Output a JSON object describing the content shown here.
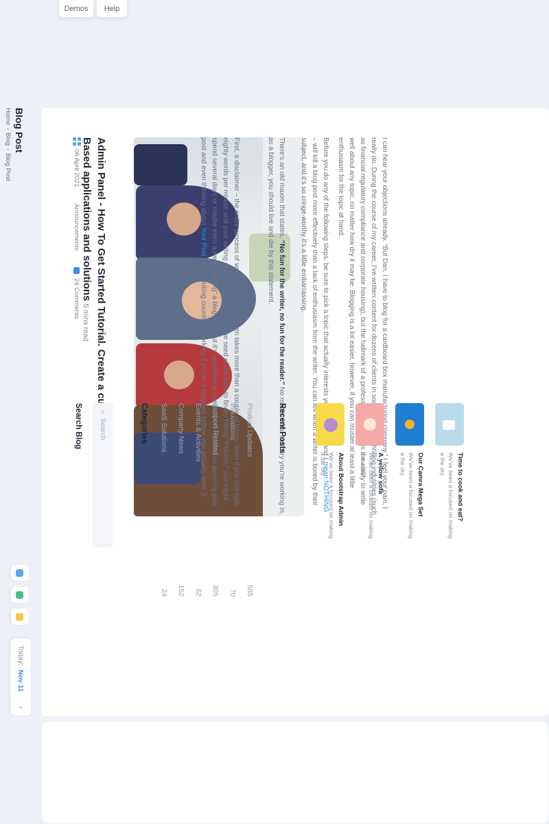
{
  "top_tabs": {
    "demos": "Demos",
    "help": "Help"
  },
  "header": {
    "title": "Blog Post",
    "breadcrumb": [
      "Home",
      "Blog",
      "Blog Post"
    ],
    "today_label": "Today:",
    "today_date": "Nov 11",
    "colors": {
      "accent": "#3b8fe5"
    }
  },
  "post": {
    "date": "06 April 2021",
    "category": "Announcements",
    "comments": "24 Comments",
    "title": "Admin Panel - How To Get Started Tutorial. Create a customizable SaaS Based applications and solutions",
    "read_time": "5 mins read",
    "p1": "First, a disclaimer – the entire process of writing a blog post often takes more than a couple of hours, even if you can type eighty words per minute and your writing skills are sharp. From the seed of the idea to finally hitting “Publish,” you might spend several days or maybe even a week “writing” a blog post, but it’s important to spend those vital hours planning your post and even thinking about",
    "p1_link": "Your Post",
    "p1_end": "(yes, thinking counts as working if you’re a blogger) before you actually write it.",
    "p2_start": "There’s an old maxim that states,",
    "p2_strong": "“No fun for the writer, no fun for the reader.”",
    "p2_end": "No matter what industry you’re working in, as a blogger, you should live and die by this statement.",
    "p3_start": "Before you do any of the following steps, be sure to pick a topic that actually interests you. Nothing – and",
    "p3_link": "I mean NOTHING",
    "p3_end": "– will kill a blog post more effectively than a lack of enthusiasm from the writer. You can tell when a writer is bored by their subject, and it’s so cringe-worthy it’s a little embarrassing.",
    "p4": "I can hear your objections already. “But Dan, I have to blog for a cardboard box manufacturing company.” I feel your pain, I really do. During the course of my career, I’ve written content for dozens of clients in some less-than-thrilling industries (such as financial regulatory compliance and corporate housing), but the hallmark of a professional blogger is the ability to write well about any topic, no matter how dry it may be. Blogging is a lot easier, however, if you can muster at least a little enthusiasm for the topic at hand."
  },
  "sidebar": {
    "search_title": "Search Blog",
    "search_placeholder": "Search",
    "categories_title": "Categories",
    "categories": [
      {
        "name": "SaaS Solutions",
        "count": "24"
      },
      {
        "name": "Company News",
        "count": "152"
      },
      {
        "name": "Events & Activities",
        "count": "52"
      },
      {
        "name": "Support Related",
        "count": "305"
      },
      {
        "name": "Innovations",
        "count": "70"
      },
      {
        "name": "Product Updates",
        "count": "585"
      }
    ],
    "recent_title": "Recent Posts",
    "recent": [
      {
        "title": "About Bootstrap Admin",
        "desc": "We’ve been a focused on making a the sky",
        "color": "#f7d94c"
      },
      {
        "title": "A yellow sofa",
        "desc": "We’ve been a focused on making a the sky",
        "color": "#f5a9a9"
      },
      {
        "title": "Our Camra Mega Set",
        "desc": "We’ve been a focused on making a the sky",
        "color": "#1f7ed1"
      },
      {
        "title": "Time to cook and eat?",
        "desc": "We’ve been a focused on making a the sky",
        "color": "#b9dbea"
      }
    ]
  }
}
